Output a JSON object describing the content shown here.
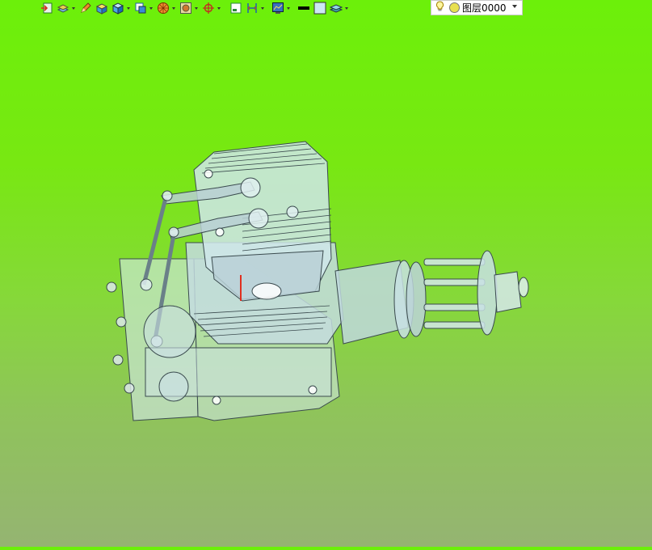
{
  "toolbar": {
    "items": [
      {
        "icon": "import-icon",
        "dropdown": false
      },
      {
        "icon": "layers-icon",
        "dropdown": true
      },
      {
        "icon": "pen-icon",
        "dropdown": false
      },
      {
        "icon": "box-yellow-icon",
        "dropdown": false
      },
      {
        "icon": "box-blue-icon",
        "dropdown": true
      },
      {
        "icon": "view-box-icon",
        "dropdown": true
      },
      {
        "icon": "render-ball-icon",
        "dropdown": true
      },
      {
        "icon": "display-mode-icon",
        "dropdown": true
      },
      {
        "icon": "crosshair-icon",
        "dropdown": true
      },
      {
        "icon": "sheet-icon",
        "dropdown": false
      },
      {
        "icon": "dimension-icon",
        "dropdown": true
      },
      {
        "icon": "screen-icon",
        "dropdown": true
      },
      {
        "icon": "line-color-icon",
        "dropdown": false
      },
      {
        "icon": "fill-color-icon",
        "dropdown": false
      },
      {
        "icon": "layer-stack-icon",
        "dropdown": true
      }
    ],
    "layer": {
      "name": "图层0000"
    }
  },
  "colors": {
    "bg_top": "#6cf00a",
    "bg_bottom": "#95b472",
    "part_fill": "#c8dfe3",
    "part_stroke": "#3a4a4e"
  },
  "viewport": {
    "model": "engine-assembly"
  }
}
